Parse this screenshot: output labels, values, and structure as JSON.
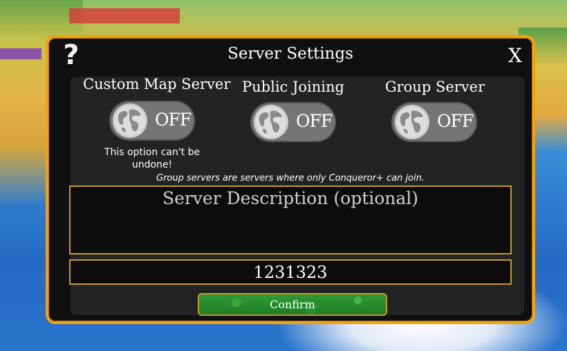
{
  "dialog": {
    "title": "Server Settings",
    "help_glyph": "?",
    "close_glyph": "X"
  },
  "options": [
    {
      "label": "Custom Map Server",
      "state": "OFF"
    },
    {
      "label": "Public Joining",
      "state": "OFF"
    },
    {
      "label": "Group Server",
      "state": "OFF"
    }
  ],
  "custom_map_warning": "This option can't be undone!",
  "group_note": "Group servers are servers where only Conqueror+ can join.",
  "description": {
    "placeholder": "Server Description (optional)",
    "value": ""
  },
  "code_field": {
    "value": "1231323"
  },
  "confirm_label": "Confirm",
  "colors": {
    "accent_border": "#f0a215",
    "field_border": "#c79a2a",
    "confirm_green": "#2f9a34",
    "toggle_gray": "#757575"
  }
}
